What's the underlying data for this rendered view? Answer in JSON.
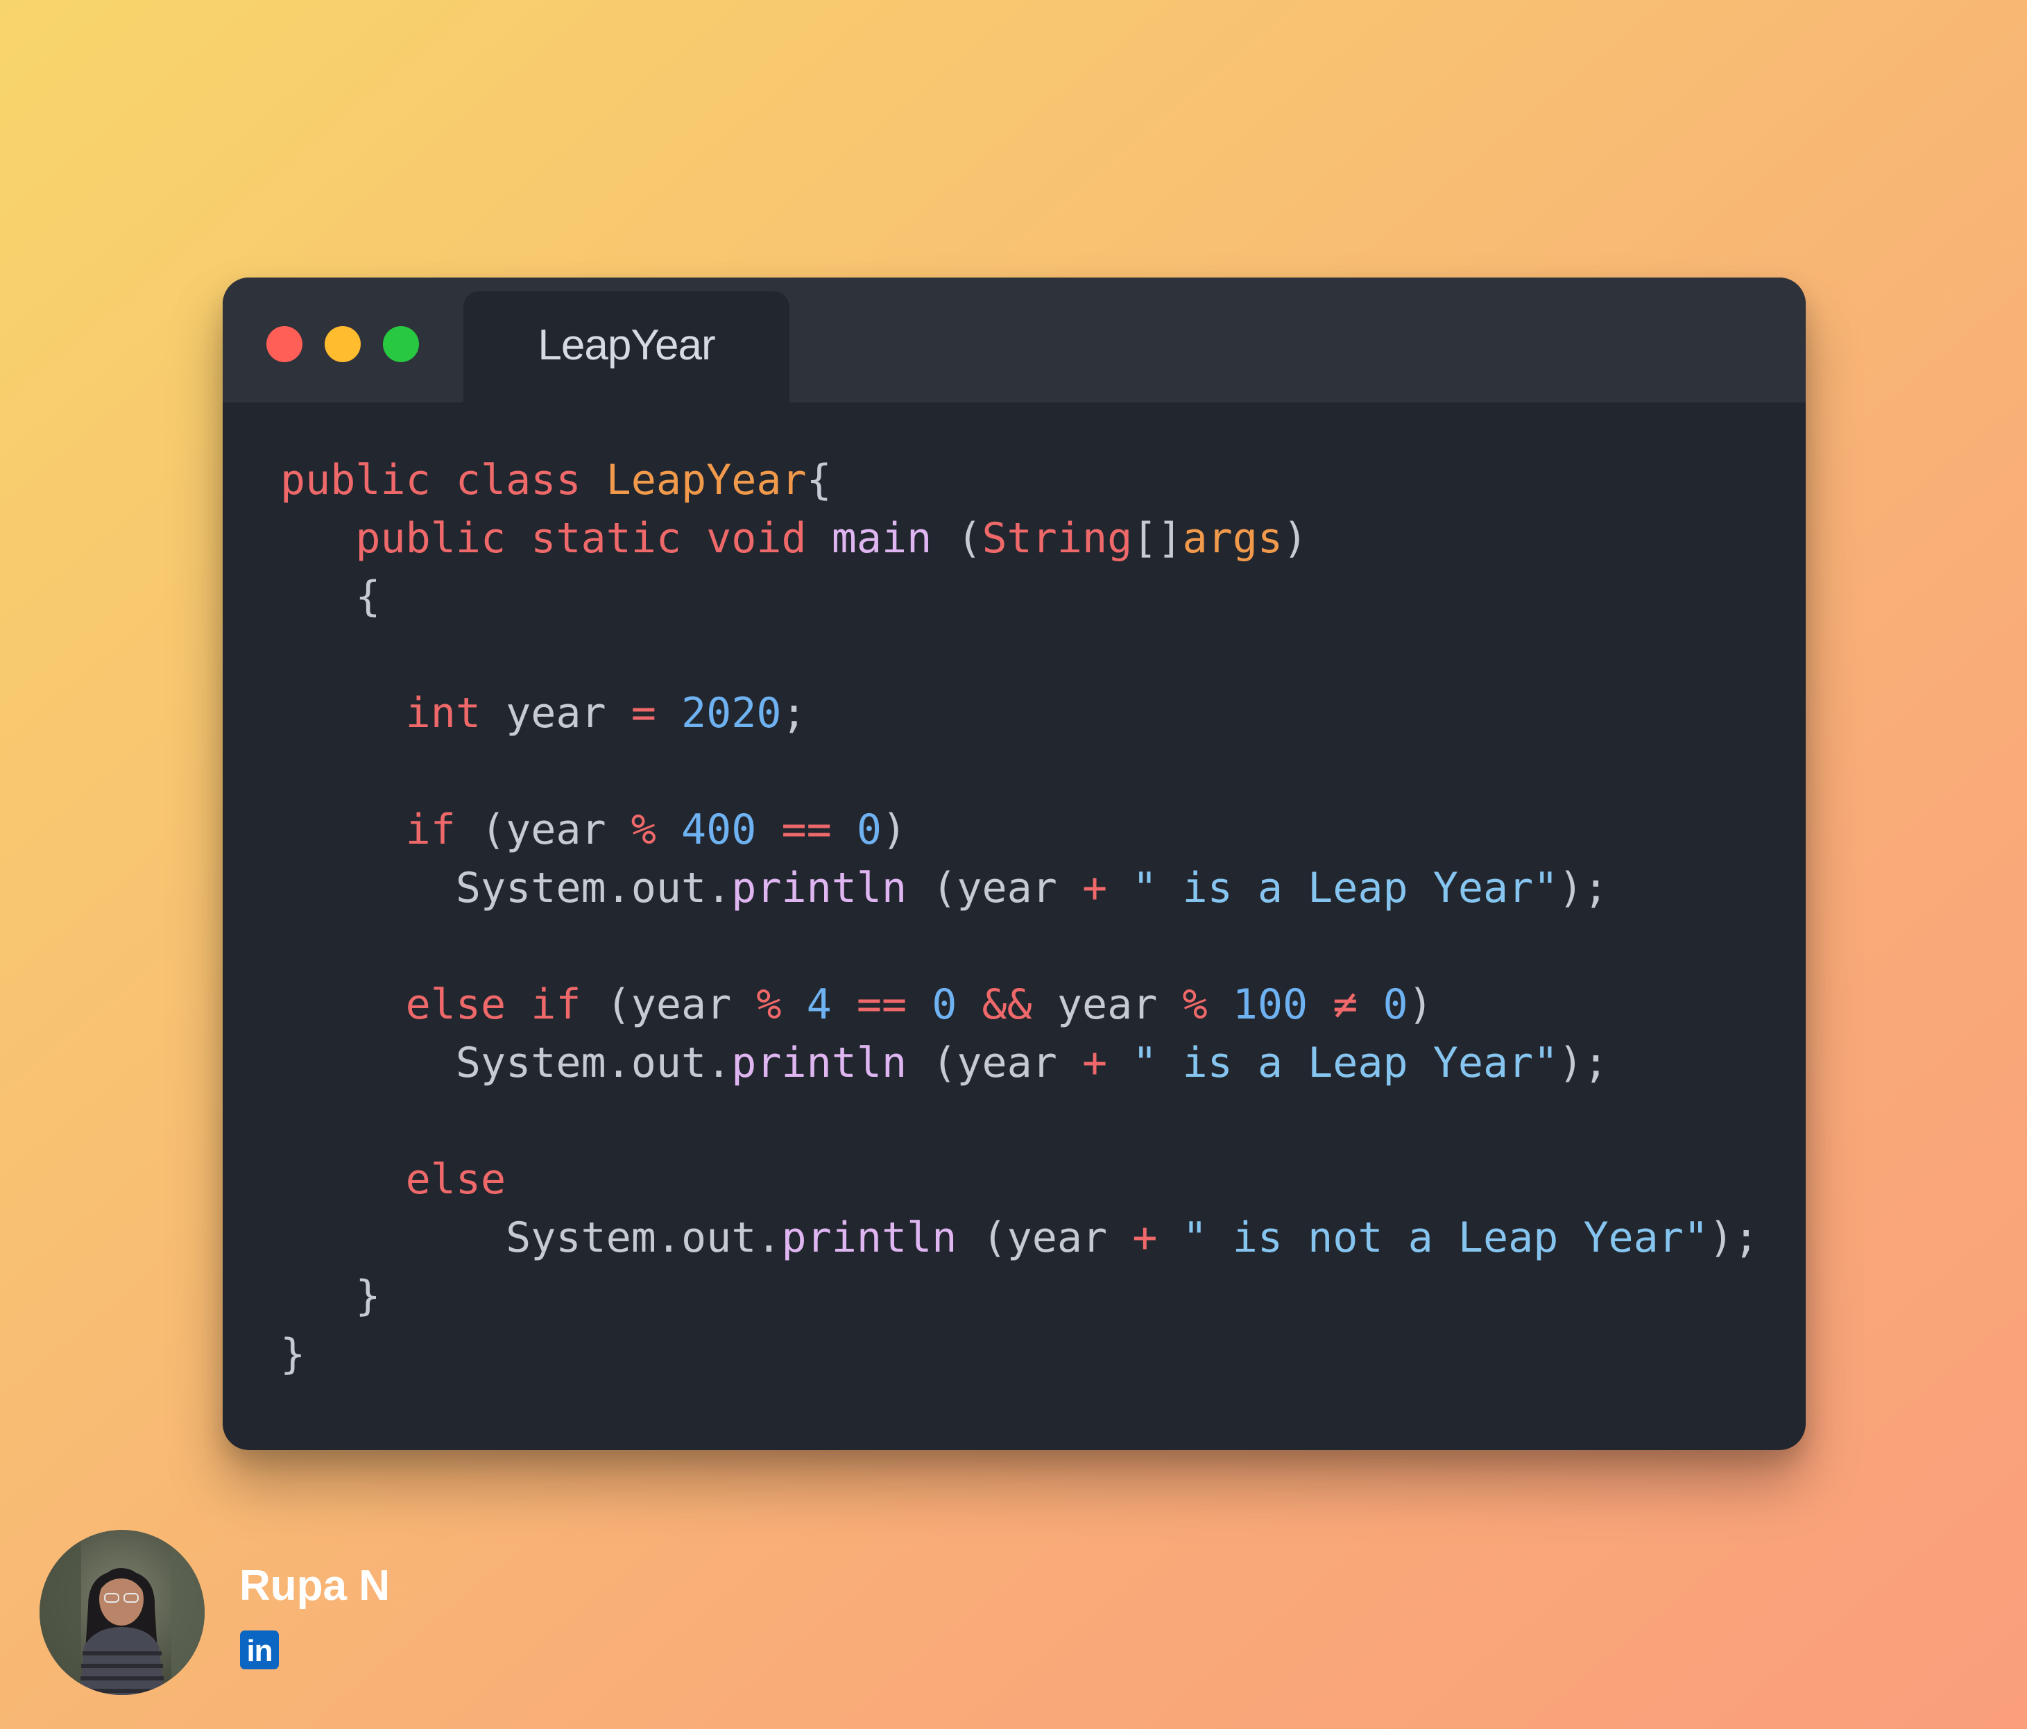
{
  "window": {
    "tab_title": "LeapYear",
    "controls": {
      "close_color": "#ff5f57",
      "minimize_color": "#febc2e",
      "maximize_color": "#28c840"
    }
  },
  "code_lines": [
    [
      {
        "t": "public class ",
        "c": "kw"
      },
      {
        "t": "LeapYear",
        "c": "cls"
      },
      {
        "t": "{",
        "c": "plain"
      }
    ],
    [
      {
        "t": "   "
      },
      {
        "t": "public static void ",
        "c": "kw"
      },
      {
        "t": "main",
        "c": "fn"
      },
      {
        "t": " (",
        "c": "plain"
      },
      {
        "t": "String",
        "c": "kw"
      },
      {
        "t": "[]",
        "c": "plain"
      },
      {
        "t": "args",
        "c": "cls"
      },
      {
        "t": ")",
        "c": "plain"
      }
    ],
    [
      {
        "t": "   {",
        "c": "plain"
      }
    ],
    [],
    [
      {
        "t": "     "
      },
      {
        "t": "int",
        "c": "kw"
      },
      {
        "t": " year ",
        "c": "plain"
      },
      {
        "t": "=",
        "c": "op"
      },
      {
        "t": " ",
        "c": "plain"
      },
      {
        "t": "2020",
        "c": "num"
      },
      {
        "t": ";",
        "c": "plain"
      }
    ],
    [],
    [
      {
        "t": "     "
      },
      {
        "t": "if",
        "c": "kw"
      },
      {
        "t": " (year ",
        "c": "plain"
      },
      {
        "t": "%",
        "c": "op"
      },
      {
        "t": " ",
        "c": "plain"
      },
      {
        "t": "400",
        "c": "num"
      },
      {
        "t": " ",
        "c": "plain"
      },
      {
        "t": "==",
        "c": "op"
      },
      {
        "t": " ",
        "c": "plain"
      },
      {
        "t": "0",
        "c": "num"
      },
      {
        "t": ")",
        "c": "plain"
      }
    ],
    [
      {
        "t": "       System.out.",
        "c": "plain"
      },
      {
        "t": "println",
        "c": "fn"
      },
      {
        "t": " (year ",
        "c": "plain"
      },
      {
        "t": "+",
        "c": "op"
      },
      {
        "t": " ",
        "c": "plain"
      },
      {
        "t": "\" is a Leap Year\"",
        "c": "str"
      },
      {
        "t": ");",
        "c": "plain"
      }
    ],
    [],
    [
      {
        "t": "     "
      },
      {
        "t": "else if",
        "c": "kw"
      },
      {
        "t": " (year ",
        "c": "plain"
      },
      {
        "t": "%",
        "c": "op"
      },
      {
        "t": " ",
        "c": "plain"
      },
      {
        "t": "4",
        "c": "num"
      },
      {
        "t": " ",
        "c": "plain"
      },
      {
        "t": "==",
        "c": "op"
      },
      {
        "t": " ",
        "c": "plain"
      },
      {
        "t": "0",
        "c": "num"
      },
      {
        "t": " ",
        "c": "plain"
      },
      {
        "t": "&&",
        "c": "op"
      },
      {
        "t": " year ",
        "c": "plain"
      },
      {
        "t": "%",
        "c": "op"
      },
      {
        "t": " ",
        "c": "plain"
      },
      {
        "t": "100",
        "c": "num"
      },
      {
        "t": " ",
        "c": "plain"
      },
      {
        "t": "≠",
        "c": "op"
      },
      {
        "t": " ",
        "c": "plain"
      },
      {
        "t": "0",
        "c": "num"
      },
      {
        "t": ")",
        "c": "plain"
      }
    ],
    [
      {
        "t": "       System.out.",
        "c": "plain"
      },
      {
        "t": "println",
        "c": "fn"
      },
      {
        "t": " (year ",
        "c": "plain"
      },
      {
        "t": "+",
        "c": "op"
      },
      {
        "t": " ",
        "c": "plain"
      },
      {
        "t": "\" is a Leap Year\"",
        "c": "str"
      },
      {
        "t": ");",
        "c": "plain"
      }
    ],
    [],
    [
      {
        "t": "     "
      },
      {
        "t": "else",
        "c": "kw"
      }
    ],
    [
      {
        "t": "         System.out.",
        "c": "plain"
      },
      {
        "t": "println",
        "c": "fn"
      },
      {
        "t": " (year ",
        "c": "plain"
      },
      {
        "t": "+",
        "c": "op"
      },
      {
        "t": " ",
        "c": "plain"
      },
      {
        "t": "\" is not a Leap Year\"",
        "c": "str"
      },
      {
        "t": ");",
        "c": "plain"
      }
    ],
    [
      {
        "t": "   }",
        "c": "plain"
      }
    ],
    [
      {
        "t": "}",
        "c": "plain"
      }
    ]
  ],
  "syntax_colors": {
    "keyword": "#f0696a",
    "class_name": "#f29a4c",
    "function": "#e0b6f2",
    "number": "#6fb2f2",
    "string": "#86c5f0",
    "plain": "#c5cad3"
  },
  "author": {
    "name": "Rupa N",
    "social_icon": "linkedin-icon",
    "social_icon_text": "in"
  }
}
